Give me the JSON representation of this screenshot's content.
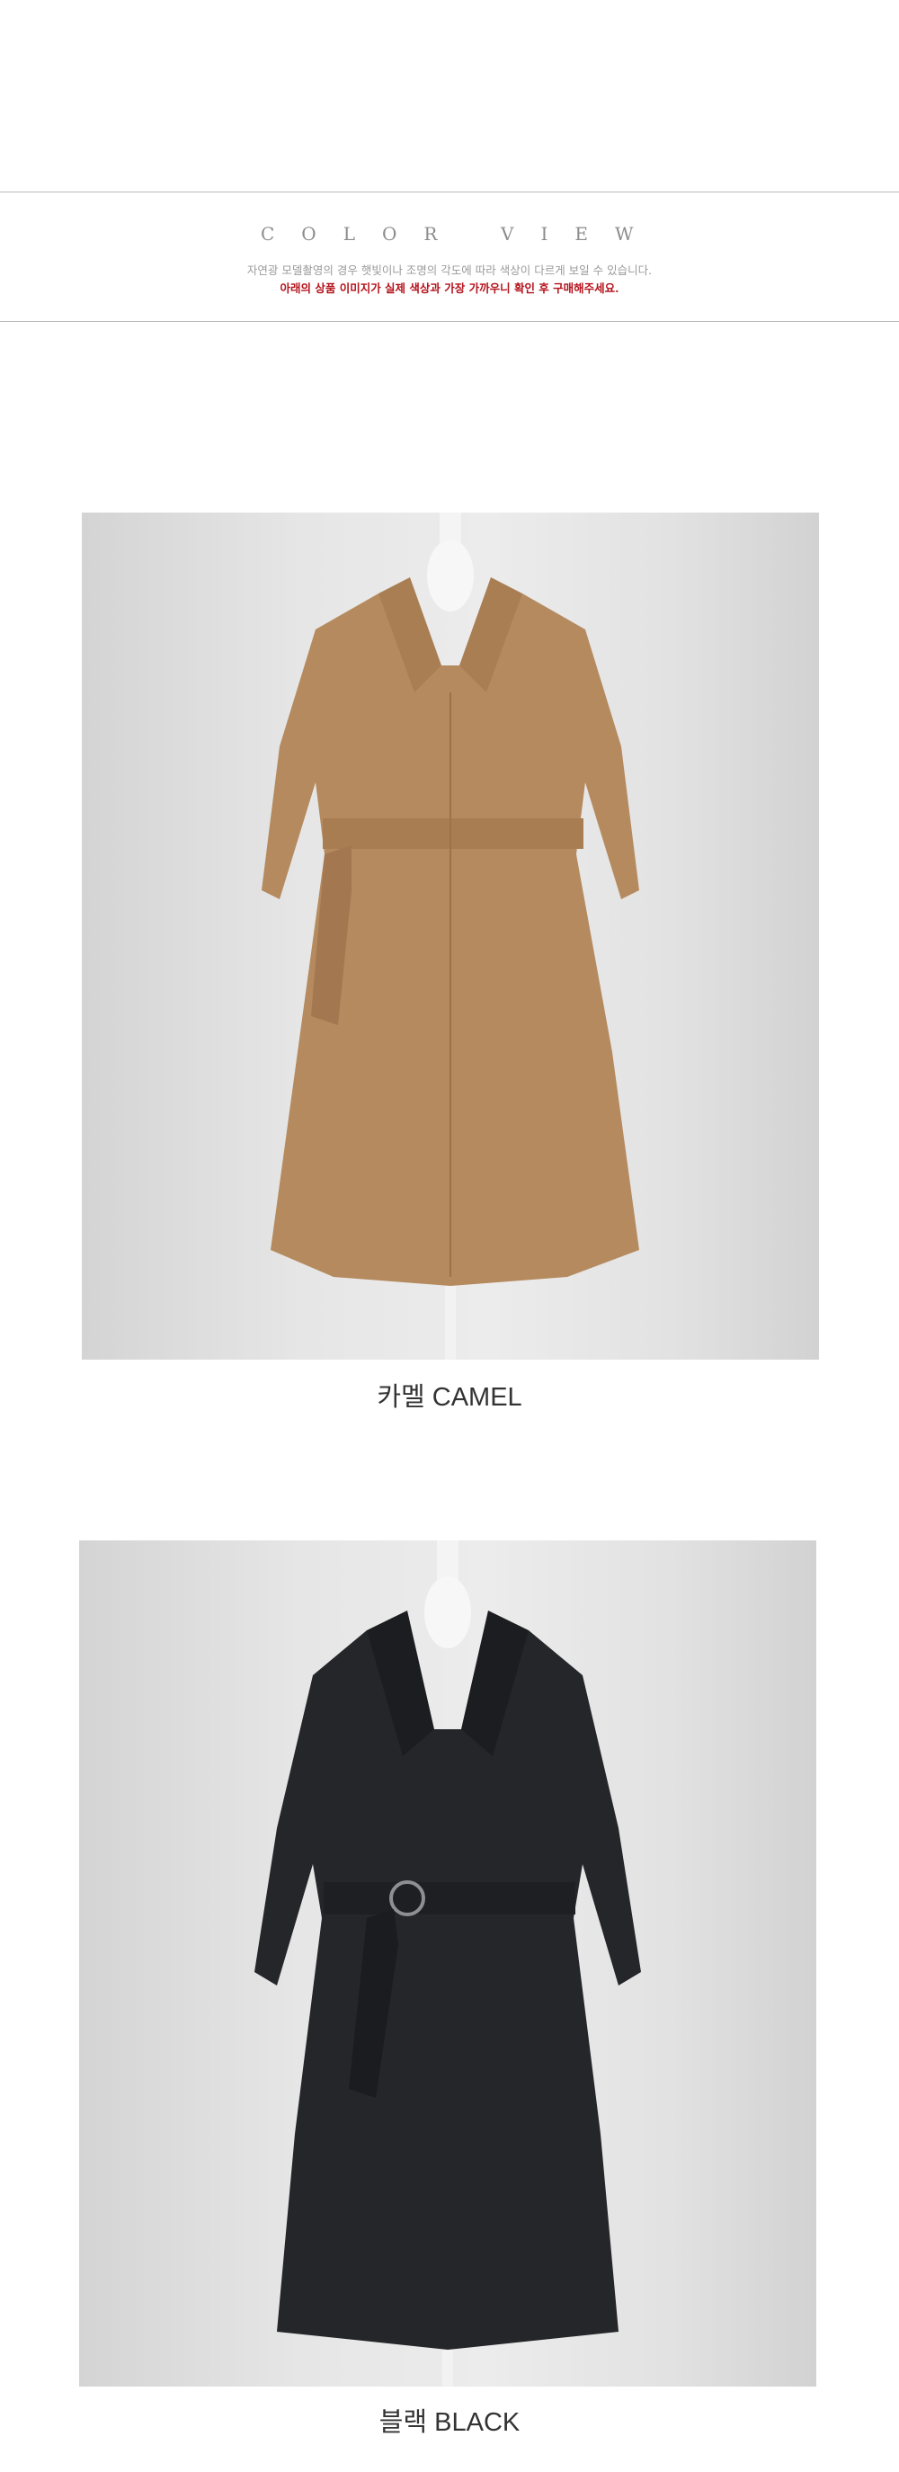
{
  "header": {
    "title_word_1": "COLOR",
    "title_word_2": "VIEW",
    "notice_line_1": "자연광 모델촬영의 경우 햇빛이나 조명의 각도에 따라 색상이 다르게 보일 수 있습니다.",
    "notice_line_2": "아래의 상품 이미지가 실제 색상과 가장 가까우니 확인 후 구매해주세요."
  },
  "colors": [
    {
      "label": "카멜 CAMEL",
      "swatch": "#b58a5e"
    },
    {
      "label": "블랙 BLACK",
      "swatch": "#242629"
    }
  ],
  "theme": {
    "rule_color": "#b9b9b9",
    "notice_accent": "#b4121b"
  }
}
